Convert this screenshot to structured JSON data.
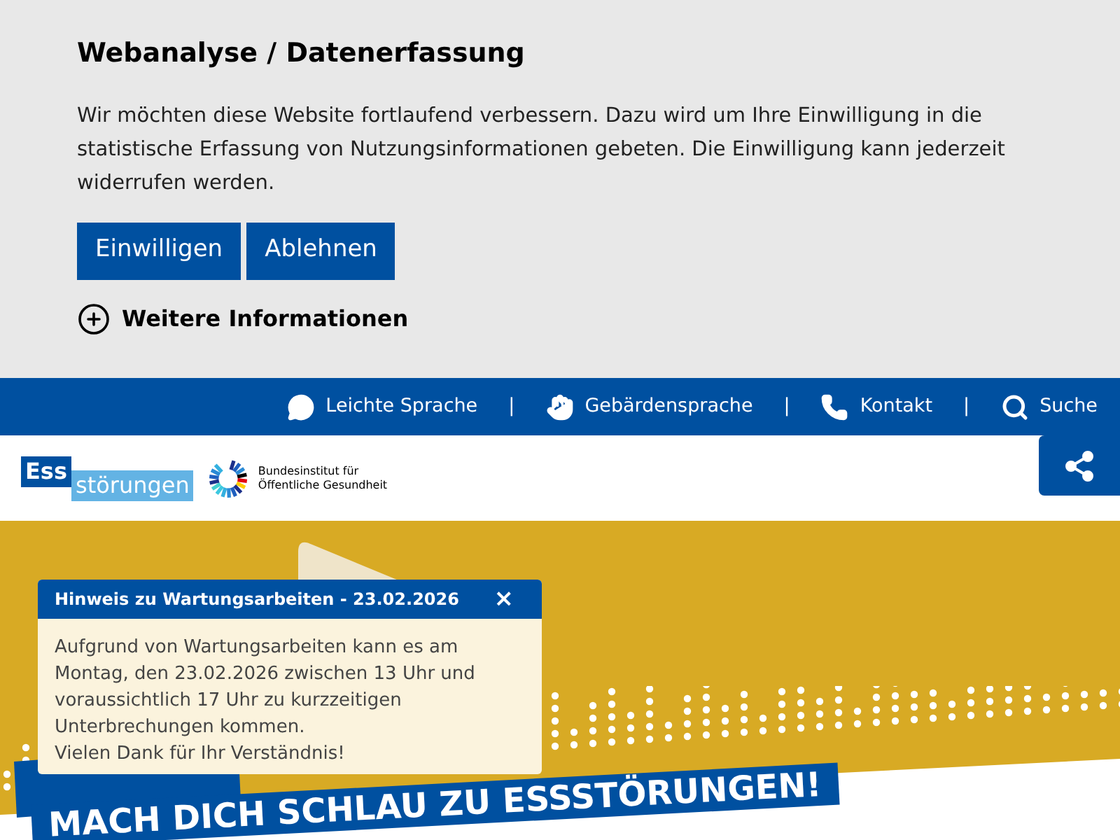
{
  "consent": {
    "title": "Webanalyse / Datenerfassung",
    "text": "Wir möchten diese Website fortlaufend verbessern. Dazu wird um Ihre Einwilligung in die statistische Erfassung von Nutzungsinformationen gebeten. Die Einwilligung kann jederzeit widerrufen werden.",
    "buttons": [
      "Einwilligen",
      "Ablehnen"
    ],
    "more": "Weitere Informationen"
  },
  "topbar": {
    "links": [
      {
        "kind": "speech",
        "label": "Leichte Sprache"
      },
      {
        "kind": "hands",
        "label": "Gebärdensprache"
      },
      {
        "kind": "phone",
        "label": "Kontakt"
      },
      {
        "kind": "search",
        "label": "Suche"
      }
    ],
    "separator": "|"
  },
  "header": {
    "logo": {
      "part1": "Ess",
      "part2": "störungen"
    },
    "institute": [
      "Bundesinstitut für",
      "Öffentliche Gesundheit"
    ]
  },
  "hero": {
    "banner_large": "MACH DICH SCHLAU ZU ESSSTÖRUNGEN!"
  },
  "notice": {
    "title": "Hinweis zu Wartungsarbeiten - 23.02.2026",
    "close": "×",
    "lines": [
      "Aufgrund von Wartungsarbeiten kann es am Montag, den 23.02.2026 zwischen 13 Uhr und voraussichtlich 17 Uhr zu kurzzeitigen Unterbrechungen kommen.",
      "Vielen Dank für Ihr Verständnis!"
    ]
  }
}
